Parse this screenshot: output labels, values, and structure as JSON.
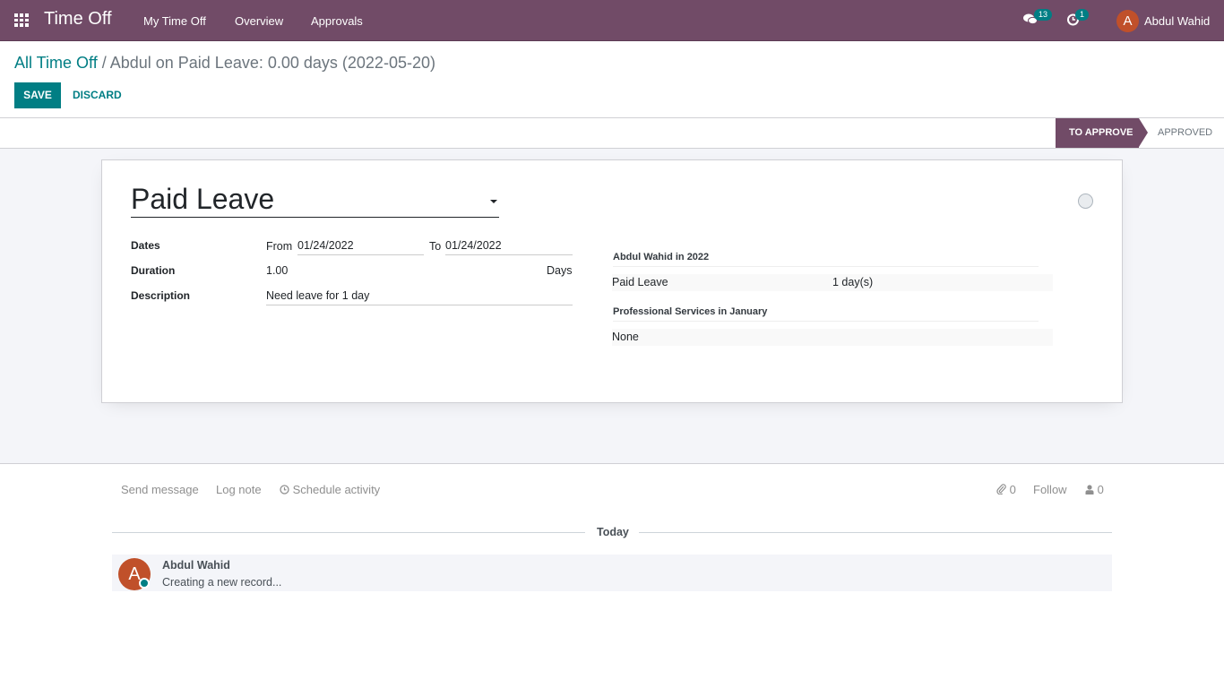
{
  "navbar": {
    "app_icon": "apps-grid-icon",
    "app_title": "Time Off",
    "menu": [
      {
        "label": "My Time Off"
      },
      {
        "label": "Overview"
      },
      {
        "label": "Approvals"
      }
    ],
    "messages_icon": "chat-bubbles-icon",
    "messages_count": "13",
    "activities_icon": "clock-icon",
    "activities_count": "1",
    "user_initial": "A",
    "user_name": "Abdul Wahid",
    "brand_color": "#714b67"
  },
  "control_panel": {
    "breadcrumb_parent": "All Time Off",
    "breadcrumb_separator": " / ",
    "breadcrumb_current": "Abdul on Paid Leave: 0.00 days (2022-05-20)",
    "save_label": "SAVE",
    "discard_label": "DISCARD",
    "accent_color": "#017e84"
  },
  "statusbar": {
    "stages": [
      {
        "label": "TO APPROVE",
        "active": true
      },
      {
        "label": "APPROVED",
        "active": false
      }
    ]
  },
  "form": {
    "leave_type": "Paid Leave",
    "fields": {
      "dates_label": "Dates",
      "from_label": "From",
      "from_value": "01/24/2022",
      "to_label": "To",
      "to_value": "01/24/2022",
      "duration_label": "Duration",
      "duration_value": "1.00",
      "duration_unit": "Days",
      "description_label": "Description",
      "description_value": "Need leave for 1 day"
    },
    "side_panel": {
      "section1_title": "Abdul Wahid in 2022",
      "section1_row_label": "Paid Leave",
      "section1_row_value": "1 day(s)",
      "section2_title": "Professional Services in January",
      "section2_row_label": "None"
    }
  },
  "chatter": {
    "send_message": "Send message",
    "log_note": "Log note",
    "schedule_activity": "Schedule activity",
    "attachments_count": "0",
    "follow_label": "Follow",
    "followers_count": "0",
    "date_separator": "Today",
    "messages": [
      {
        "initial": "A",
        "author": "Abdul Wahid",
        "body": "Creating a new record..."
      }
    ]
  }
}
